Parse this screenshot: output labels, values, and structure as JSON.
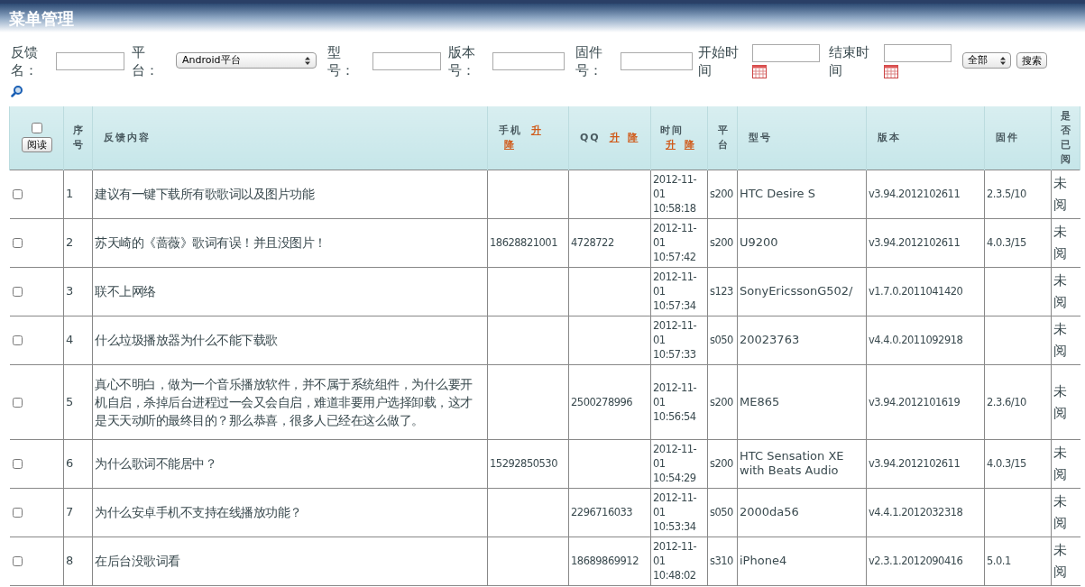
{
  "page_title": "菜单管理",
  "filters": [
    {
      "kind": "text",
      "label": "反馈名："
    },
    {
      "kind": "select",
      "label": "平台：",
      "value": "Android平台"
    },
    {
      "kind": "text",
      "label": "型号："
    },
    {
      "kind": "text",
      "label": "版本号："
    },
    {
      "kind": "text",
      "label": "固件号："
    },
    {
      "kind": "date",
      "label": "开始时间"
    },
    {
      "kind": "date",
      "label": "结束时间"
    }
  ],
  "scope_select": {
    "value": "全部"
  },
  "search_button": "搜索",
  "table": {
    "select_all": {
      "checked": false
    },
    "read_button": "阅读",
    "columns": [
      {
        "label": "序号"
      },
      {
        "label": "反馈内容"
      },
      {
        "label": "手机",
        "sort": [
          "升",
          "降"
        ]
      },
      {
        "label": "QQ",
        "sort": [
          "升",
          "降"
        ]
      },
      {
        "label": "时间",
        "sort": [
          "升",
          "降"
        ]
      },
      {
        "label": "平台"
      },
      {
        "label": "型号"
      },
      {
        "label": "版本"
      },
      {
        "label": "固件"
      },
      {
        "label": "是否已阅"
      }
    ],
    "rows": [
      {
        "checked": false,
        "cells": [
          "1",
          "建议有一键下载所有歌歌词以及图片功能",
          "",
          "",
          "2012-11-01 10:58:18",
          "s200",
          "HTC Desire S",
          "v3.94.2012102611",
          "2.3.5/10",
          "未阅"
        ]
      },
      {
        "checked": false,
        "cells": [
          "2",
          "苏天崎的《蔷薇》歌词有误！并且没图片！",
          "18628821001",
          "4728722",
          "2012-11-01 10:57:42",
          "s200",
          "U9200",
          "v3.94.2012102611",
          "4.0.3/15",
          "未阅"
        ]
      },
      {
        "checked": false,
        "cells": [
          "3",
          "联不上网络",
          "",
          "",
          "2012-11-01 10:57:34",
          "s123",
          "SonyEricssonG502/",
          "v1.7.0.2011041420",
          "",
          "未阅"
        ]
      },
      {
        "checked": false,
        "cells": [
          "4",
          "什么垃圾播放器为什么不能下载歌",
          "",
          "",
          "2012-11-01 10:57:33",
          "s050",
          "20023763",
          "v4.4.0.2011092918",
          "",
          "未阅"
        ]
      },
      {
        "checked": false,
        "cells": [
          "5",
          "真心不明白，做为一个音乐播放软件，并不属于系统组件，为什么要开机自启，杀掉后台进程过一会又会自启，难道非要用户选择卸载，这才是天天动听的最终目的？那么恭喜，很多人已经在这么做了。",
          "",
          "2500278996",
          "2012-11-01 10:56:54",
          "s200",
          "ME865",
          "v3.94.2012101619",
          "2.3.6/10",
          "未阅"
        ]
      },
      {
        "checked": false,
        "cells": [
          "6",
          "为什么歌词不能居中？",
          "15292850530",
          "",
          "2012-11-01 10:54:29",
          "s200",
          "HTC Sensation XE with Beats Audio",
          "v3.94.2012102611",
          "4.0.3/15",
          "未阅"
        ]
      },
      {
        "checked": false,
        "cells": [
          "7",
          "为什么安卓手机不支持在线播放功能？",
          "",
          "2296716033",
          "2012-11-01 10:53:34",
          "s050",
          "2000da56",
          "v4.4.1.2012032318",
          "",
          "未阅"
        ]
      },
      {
        "checked": false,
        "cells": [
          "8",
          "在后台没歌词看",
          "",
          "18689869912",
          "2012-11-01 10:48:02",
          "s310",
          "iPhone4",
          "v2.3.1.2012090416",
          "5.0.1",
          "未阅"
        ]
      }
    ]
  }
}
